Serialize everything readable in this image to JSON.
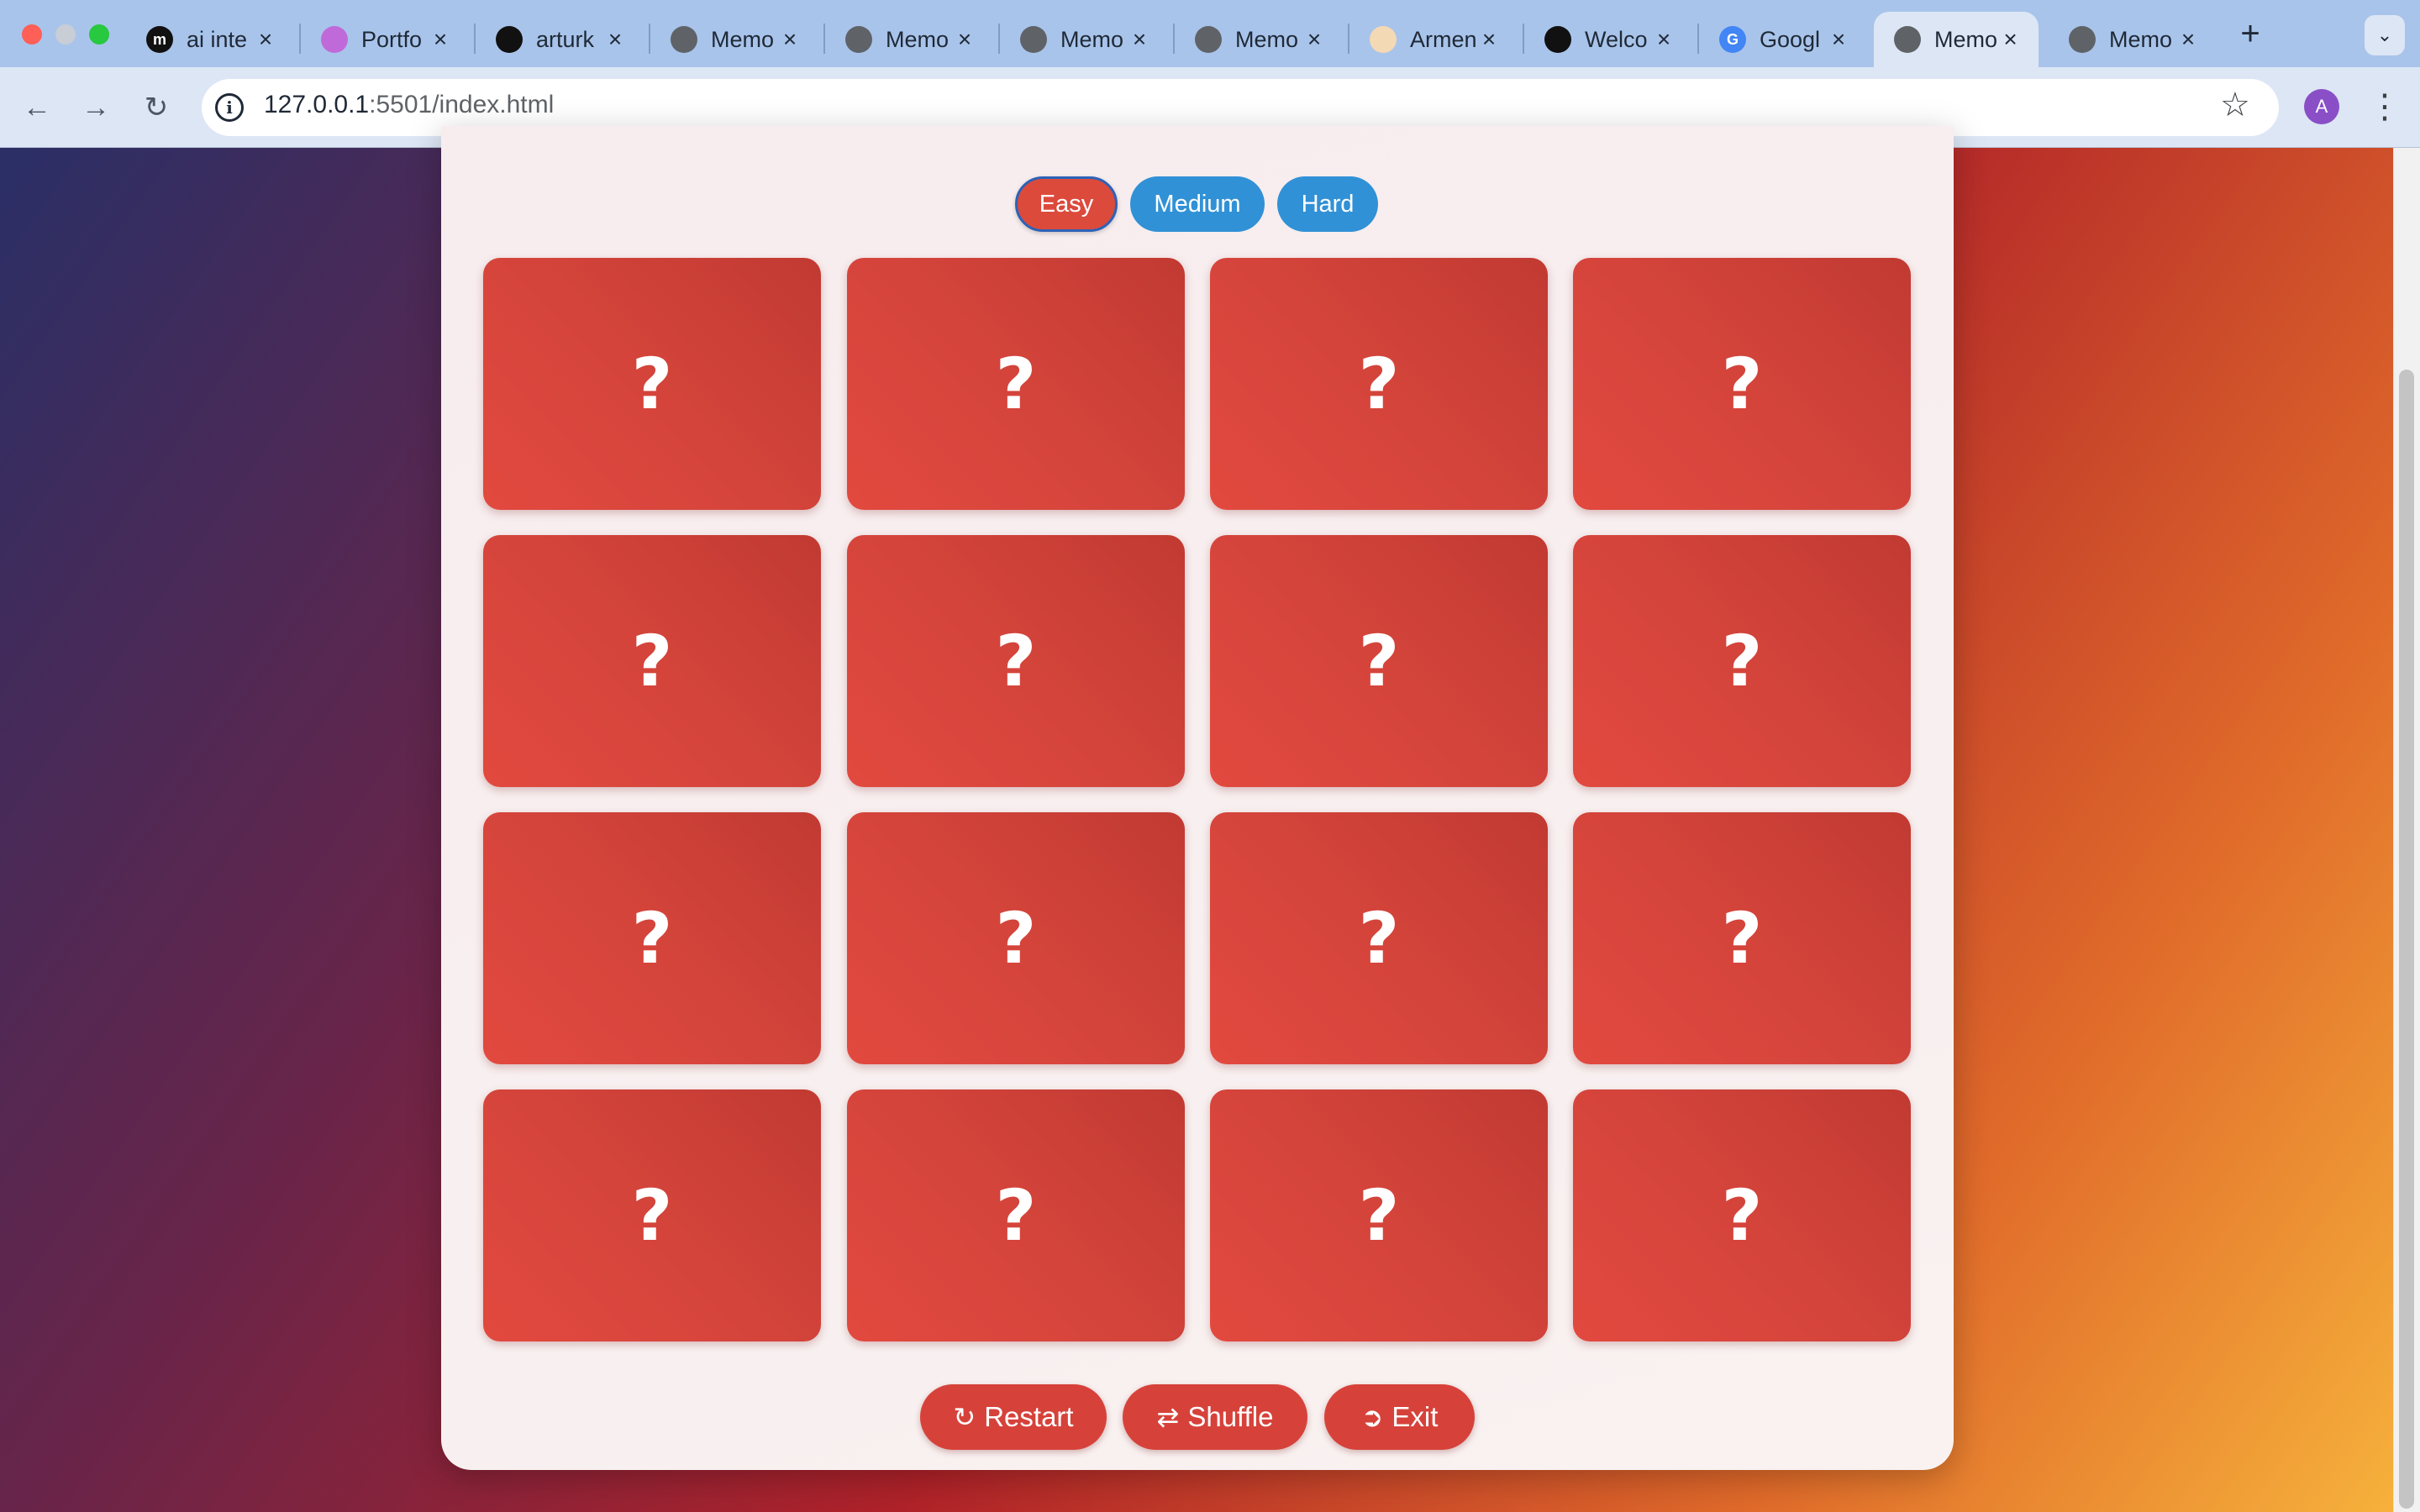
{
  "browser": {
    "tabs": [
      {
        "title": "ai inte",
        "favicon": "medium-icon",
        "fav_color": "#111111",
        "fav_char": "m"
      },
      {
        "title": "Portfo",
        "favicon": "portfolio-icon",
        "fav_color": "#c06ad9",
        "fav_char": ""
      },
      {
        "title": "arturk",
        "favicon": "github-icon",
        "fav_color": "#111111",
        "fav_char": ""
      },
      {
        "title": "Memo",
        "favicon": "globe-icon",
        "fav_color": "#5f6368",
        "fav_char": ""
      },
      {
        "title": "Memo",
        "favicon": "globe-icon",
        "fav_color": "#5f6368",
        "fav_char": ""
      },
      {
        "title": "Memo",
        "favicon": "globe-icon",
        "fav_color": "#5f6368",
        "fav_char": ""
      },
      {
        "title": "Memo",
        "favicon": "globe-icon",
        "fav_color": "#5f6368",
        "fav_char": ""
      },
      {
        "title": "Armen",
        "favicon": "feather-icon",
        "fav_color": "#f4d9b5",
        "fav_char": ""
      },
      {
        "title": "Welco",
        "favicon": "openai-icon",
        "fav_color": "#111111",
        "fav_char": ""
      },
      {
        "title": "Googl",
        "favicon": "google-translate-icon",
        "fav_color": "#4285f4",
        "fav_char": "G"
      },
      {
        "title": "Memo",
        "favicon": "globe-icon",
        "fav_color": "#5f6368",
        "fav_char": "",
        "active": true
      },
      {
        "title": "Memo",
        "favicon": "globe-icon",
        "fav_color": "#5f6368",
        "fav_char": ""
      }
    ],
    "url_host": "127.0.0.1",
    "url_path": ":5501/index.html",
    "profile_initial": "A"
  },
  "game": {
    "difficulty": {
      "easy": "Easy",
      "medium": "Medium",
      "hard": "Hard",
      "selected": "Easy"
    },
    "card_face": "?",
    "card_count": 16,
    "actions": {
      "restart": "Restart",
      "shuffle": "Shuffle",
      "exit": "Exit"
    }
  },
  "colors": {
    "card": "#d6443b",
    "difficulty_active": "#dc4a3c",
    "difficulty_inactive": "#3191d6",
    "action_button": "#d6423a"
  }
}
